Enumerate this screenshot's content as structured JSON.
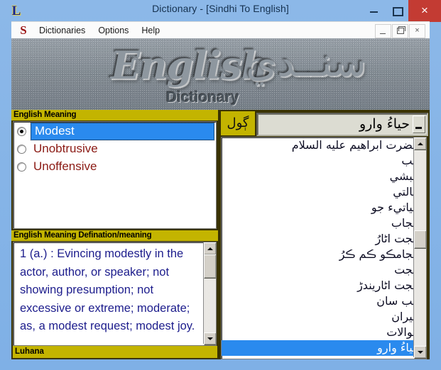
{
  "window": {
    "title": "Dictionary - [Sindhi To English]",
    "app_icon": "L",
    "controls": {
      "minimize": "minimize-icon",
      "maximize": "maximize-icon",
      "close": "×"
    }
  },
  "mdi": {
    "icon": "S",
    "menus": [
      "Dictionaries",
      "Options",
      "Help"
    ],
    "controls": {
      "minimize": "minimize-icon",
      "restore": "restore-icon",
      "close": "×"
    }
  },
  "banner": {
    "english": "English",
    "sindhi": "سنــدي",
    "subtitle": "Dictionary"
  },
  "left_panel": {
    "meaning_header": "English Meaning",
    "meanings": [
      {
        "label": "Modest",
        "selected": true
      },
      {
        "label": "Unobtrusive",
        "selected": false
      },
      {
        "label": "Unoffensive",
        "selected": false
      }
    ],
    "definition_header": "English Meaning Defination/meaning",
    "definition_text": "1        (a.)  :   Evincing modestly in the actor, author, or speaker; not showing presumption; not excessive or extreme; moderate; as, a modest request; modest joy.",
    "status_text": "Luhana"
  },
  "right_panel": {
    "search_label": "ڳول",
    "search_value": "حياءُ وارو",
    "search_placeholder": "",
    "words": [
      {
        "text": "حضرت ابراهيم عليه السلام",
        "selected": false
      },
      {
        "text": "حَب",
        "selected": false
      },
      {
        "text": "حبشي",
        "selected": false
      },
      {
        "text": "حالتي",
        "selected": false
      },
      {
        "text": "حياتيء جو",
        "selected": false
      },
      {
        "text": "حجاب",
        "selected": false
      },
      {
        "text": "حجت اٹارُ",
        "selected": false
      },
      {
        "text": "حجامڪو ڪم ڪرُ",
        "selected": false
      },
      {
        "text": "حجت",
        "selected": false
      },
      {
        "text": "حُجت اٹاريندڑ",
        "selected": false
      },
      {
        "text": "حُب سان",
        "selected": false
      },
      {
        "text": "حيران",
        "selected": false
      },
      {
        "text": "حوالات",
        "selected": false
      },
      {
        "text": "حياءُ وارو",
        "selected": true
      }
    ]
  },
  "colors": {
    "title_bar": "#8cb8e8",
    "close_button": "#c33b33",
    "panel_header": "#c3b400",
    "panel_frame": "#3a3302",
    "selection": "#2a8aee",
    "meaning_text": "#8b1a14",
    "definition_text": "#1c1c8c"
  }
}
